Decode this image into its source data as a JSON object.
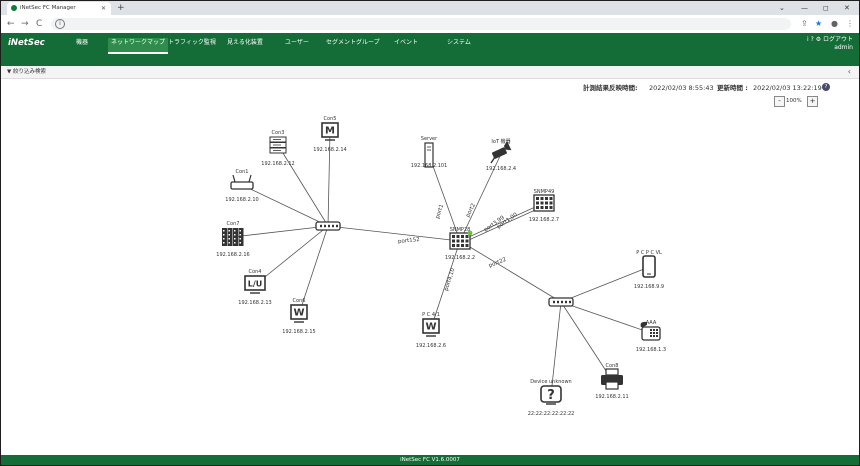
{
  "browser": {
    "tab_title": "iNetSec FC Manager",
    "new_tab": "+",
    "window_controls": [
      "⌄",
      "—",
      "◻",
      "✕"
    ],
    "nav": [
      "←",
      "→",
      "C"
    ]
  },
  "header": {
    "logo": "iNetSec",
    "nav_items": [
      {
        "label": "機器"
      },
      {
        "label": "ネットワークマップ",
        "active": true
      },
      {
        "label": "トラフィック監視"
      },
      {
        "label": "見える化装置"
      },
      {
        "label": "ユーザー"
      },
      {
        "label": "セグメントグループ"
      },
      {
        "label": "イベント"
      },
      {
        "label": "システム"
      }
    ],
    "right_icons": "i ? ⚙ ログアウト",
    "user": "admin"
  },
  "filter_label": "絞り込み検索",
  "status": {
    "measure_label": "計測結果反映時間:",
    "measure_time": "2022/02/03 8:55:43",
    "update_label": "更新時間 :",
    "update_time": "2022/02/03 13:22:19"
  },
  "zoom": {
    "minus": "-",
    "value": "100%",
    "plus": "+"
  },
  "map": {
    "nodes": [
      {
        "id": "hub1",
        "icon": "switch",
        "name": "",
        "ip": ""
      },
      {
        "id": "core",
        "icon": "core-switch",
        "name": "SNMP28",
        "ip": "192.168.2.2"
      },
      {
        "id": "hub2",
        "icon": "switch",
        "name": "",
        "ip": ""
      },
      {
        "id": "con3",
        "icon": "server",
        "name": "Con3",
        "ip": "192.168.2.12"
      },
      {
        "id": "con5",
        "icon": "mac",
        "name": "Con5",
        "ip": "192.168.2.14",
        "glyph": "M"
      },
      {
        "id": "con1",
        "icon": "router",
        "name": "Con1",
        "ip": "192.168.2.10"
      },
      {
        "id": "con7",
        "icon": "building",
        "name": "Con7",
        "ip": "192.168.2.16"
      },
      {
        "id": "con4",
        "icon": "linux",
        "name": "Con4",
        "ip": "192.168.2.13",
        "glyph": "L/U"
      },
      {
        "id": "con6",
        "icon": "windows",
        "name": "Con6",
        "ip": "192.168.2.15",
        "glyph": "W"
      },
      {
        "id": "server",
        "icon": "tower",
        "name": "Server",
        "ip": "192.168.2.101"
      },
      {
        "id": "iot",
        "icon": "camera",
        "name": "IoT 機器",
        "ip": "192.168.2.4"
      },
      {
        "id": "snmp9",
        "icon": "switch-grid",
        "name": "SNMP49",
        "ip": "192.168.2.7"
      },
      {
        "id": "pc4",
        "icon": "windows",
        "name": "P C 4/1",
        "ip": "192.168.2.6",
        "glyph": "W"
      },
      {
        "id": "phone",
        "icon": "smartphone",
        "name": "P C P C VL",
        "ip": "192.168.9.9"
      },
      {
        "id": "aaa",
        "icon": "telephone",
        "name": "AAA",
        "ip": "192.168.1.3"
      },
      {
        "id": "printer",
        "icon": "printer",
        "name": "Con8",
        "ip": "192.168.2.11"
      },
      {
        "id": "unknown",
        "icon": "unknown",
        "name": "Device unknown",
        "ip": "22:22:22:22:22:22",
        "glyph": "?"
      }
    ],
    "links": [
      {
        "from": "hub1",
        "to": "con3"
      },
      {
        "from": "hub1",
        "to": "con5"
      },
      {
        "from": "hub1",
        "to": "con1"
      },
      {
        "from": "hub1",
        "to": "con7"
      },
      {
        "from": "hub1",
        "to": "con4"
      },
      {
        "from": "hub1",
        "to": "con6"
      },
      {
        "from": "hub1",
        "to": "core",
        "label": "port152"
      },
      {
        "from": "core",
        "to": "server",
        "label": "port1"
      },
      {
        "from": "core",
        "to": "iot",
        "label": "port2"
      },
      {
        "from": "core",
        "to": "snmp9",
        "label": "port3,99"
      },
      {
        "from": "core",
        "to": "snmp9",
        "label": "port1,00"
      },
      {
        "from": "core",
        "to": "pc4",
        "label": "port4,10"
      },
      {
        "from": "core",
        "to": "hub2",
        "label": "port22"
      },
      {
        "from": "hub2",
        "to": "phone"
      },
      {
        "from": "hub2",
        "to": "aaa"
      },
      {
        "from": "hub2",
        "to": "printer"
      },
      {
        "from": "hub2",
        "to": "unknown"
      }
    ]
  },
  "footer": "iNetSec FC V1.6.0007"
}
